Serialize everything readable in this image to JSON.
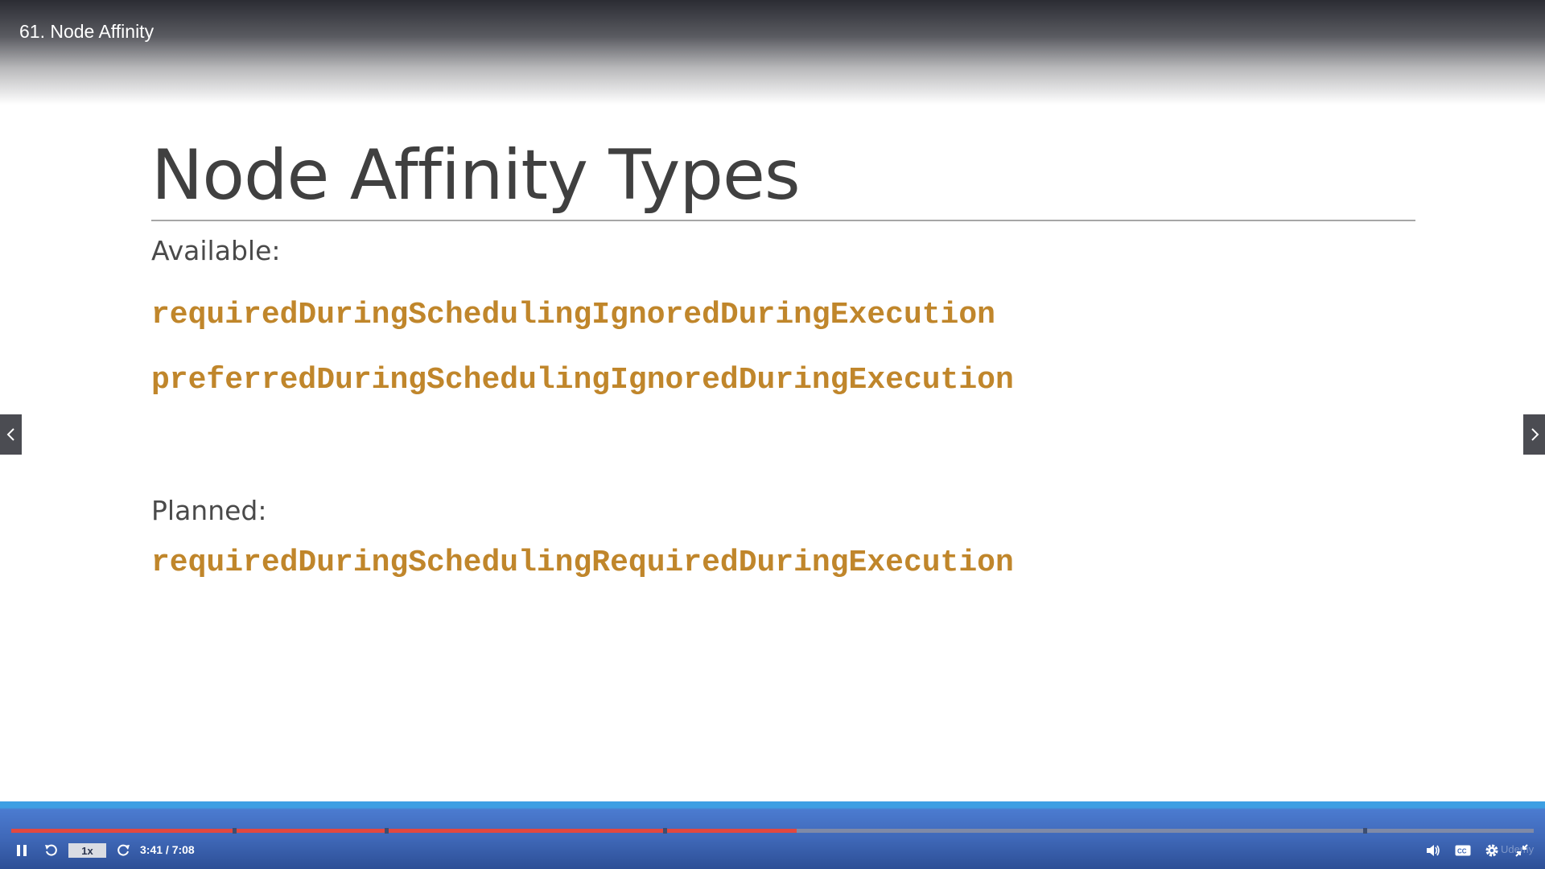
{
  "header": {
    "lecture_title": "61. Node Affinity"
  },
  "slide": {
    "title": "Node Affinity Types",
    "available_label": "Available:",
    "available_items": [
      "requiredDuringSchedulingIgnoredDuringExecution",
      "preferredDuringSchedulingIgnoredDuringExecution"
    ],
    "planned_label": "Planned:",
    "planned_items": [
      "requiredDuringSchedulingRequiredDuringExecution"
    ]
  },
  "player": {
    "speed_label": "1x",
    "time_display": "3:41 / 7:08",
    "progress_fraction": 0.516,
    "watermark": "Udemy",
    "accent_color": "#e2483f",
    "icons": [
      "pause-icon",
      "rewind-icon",
      "forward-icon",
      "volume-icon",
      "captions-icon",
      "settings-icon",
      "exit-fullscreen-icon"
    ]
  },
  "colors": {
    "code": "#c0862b",
    "title": "#404040"
  }
}
